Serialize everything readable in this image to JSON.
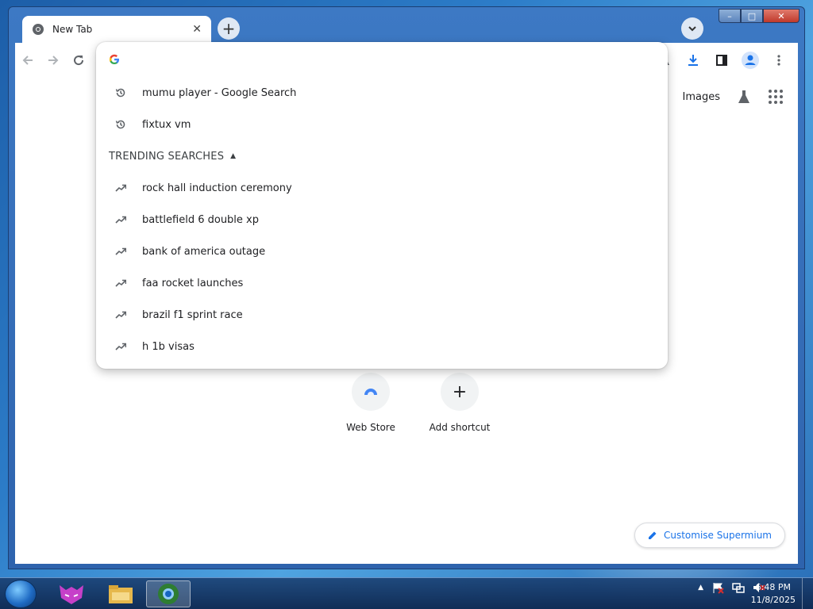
{
  "browser": {
    "tab": {
      "title": "New Tab"
    },
    "window_controls": {
      "minimize": "–",
      "maximize": "□",
      "close": "✕"
    }
  },
  "omnibox": {
    "input_value": "",
    "recent": [
      {
        "text": "mumu player - Google Search",
        "icon": "history-icon"
      },
      {
        "text": "fixtux vm",
        "icon": "history-icon"
      }
    ],
    "trending_header": "TRENDING SEARCHES",
    "trending": [
      {
        "text": "rock hall induction ceremony",
        "icon": "trending-icon"
      },
      {
        "text": "battlefield 6 double xp",
        "icon": "trending-icon"
      },
      {
        "text": "bank of america outage",
        "icon": "trending-icon"
      },
      {
        "text": "faa rocket launches",
        "icon": "trending-icon"
      },
      {
        "text": "brazil f1 sprint race",
        "icon": "trending-icon"
      },
      {
        "text": "h 1b visas",
        "icon": "trending-icon"
      }
    ]
  },
  "newtab": {
    "images_link": "Images",
    "shortcuts": [
      {
        "label": "Web Store",
        "icon": "web-store-icon"
      },
      {
        "label": "Add shortcut",
        "icon": "plus-icon"
      }
    ],
    "customise_label": "Customise Supermium"
  },
  "taskbar": {
    "time": "6:48 PM",
    "date": "11/8/2025"
  }
}
